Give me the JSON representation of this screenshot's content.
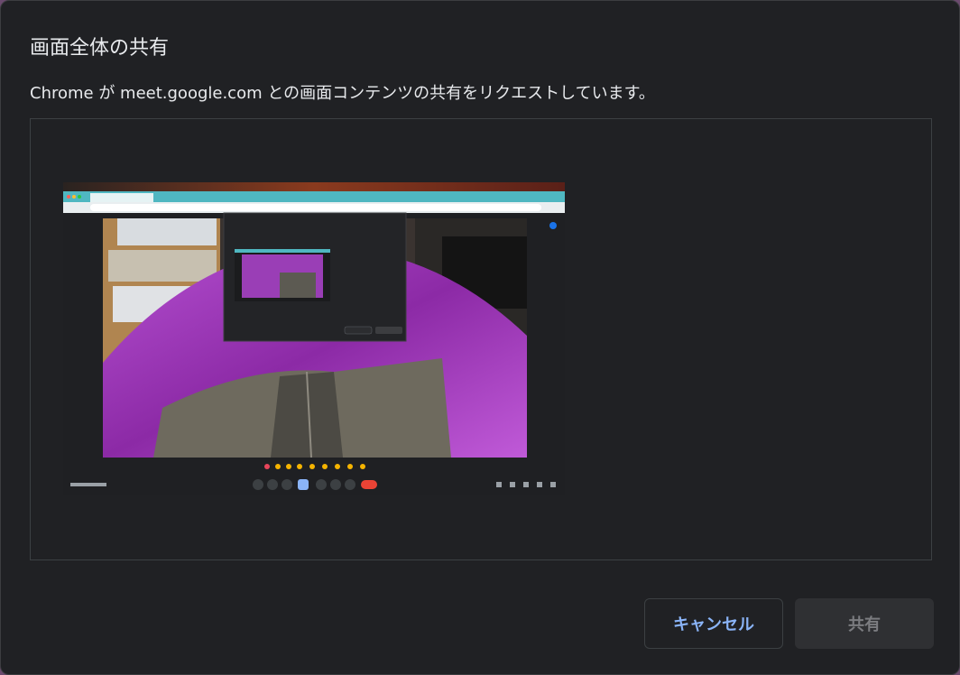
{
  "dialog": {
    "title": "画面全体の共有",
    "subtitle": "Chrome が meet.google.com との画面コンテンツの共有をリクエストしています。"
  },
  "preview": {
    "icon": "screen-thumbnail",
    "emoji_bar": [
      "❤",
      "👍",
      "🎉",
      "👏",
      "😂",
      "😮",
      "😢",
      "🤔",
      "👎"
    ]
  },
  "buttons": {
    "cancel_label": "キャンセル",
    "share_label": "共有"
  },
  "colors": {
    "dialog_bg": "#202124",
    "accent": "#8ab4f8",
    "disabled_text": "#7b7c80",
    "browser_tab_bar": "#4fb7c1",
    "jacket_purple": "#a03cc0",
    "end_call_red": "#ea4335"
  }
}
